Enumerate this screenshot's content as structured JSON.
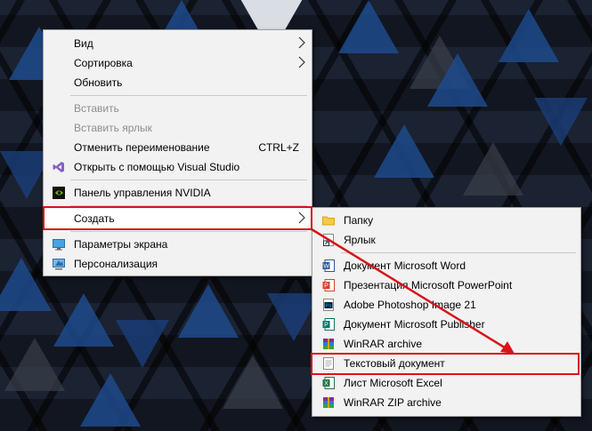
{
  "context_menu": {
    "items": [
      {
        "label": "Вид"
      },
      {
        "label": "Сортировка"
      },
      {
        "label": "Обновить"
      },
      {
        "label": "Вставить"
      },
      {
        "label": "Вставить ярлык"
      },
      {
        "label": "Отменить переименование",
        "shortcut": "CTRL+Z"
      },
      {
        "label": "Открыть с помощью Visual Studio",
        "icon": "visual-studio-icon"
      },
      {
        "label": "Панель управления NVIDIA",
        "icon": "nvidia-icon"
      },
      {
        "label": "Создать"
      },
      {
        "label": "Параметры экрана",
        "icon": "display-icon"
      },
      {
        "label": "Персонализация",
        "icon": "personalization-icon"
      }
    ]
  },
  "create_submenu": {
    "items": [
      {
        "label": "Папку",
        "icon": "folder-icon"
      },
      {
        "label": "Ярлык",
        "icon": "shortcut-icon"
      },
      {
        "label": "Документ Microsoft Word",
        "icon": "word-icon"
      },
      {
        "label": "Презентация Microsoft PowerPoint",
        "icon": "powerpoint-icon"
      },
      {
        "label": "Adobe Photoshop Image 21",
        "icon": "photoshop-icon"
      },
      {
        "label": "Документ Microsoft Publisher",
        "icon": "publisher-icon"
      },
      {
        "label": "WinRAR archive",
        "icon": "winrar-icon"
      },
      {
        "label": "Текстовый документ",
        "icon": "text-document-icon"
      },
      {
        "label": "Лист Microsoft Excel",
        "icon": "excel-icon"
      },
      {
        "label": "WinRAR ZIP archive",
        "icon": "winrar-zip-icon"
      }
    ]
  },
  "colors": {
    "highlight": "#d7141a",
    "menu_bg": "#f2f2f2"
  }
}
